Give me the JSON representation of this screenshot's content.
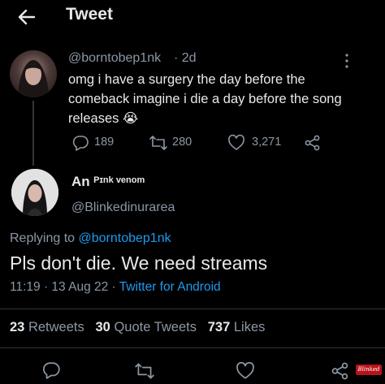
{
  "header": {
    "back_label": "←",
    "title": "Tweet"
  },
  "parent_tweet": {
    "handle": "@borntobep1nk",
    "time": "· 2d",
    "text": "omg i have a surgery the day before the comeback imagine i die a day before the song releases 😭",
    "replies": "189",
    "retweets": "280",
    "likes": "3,271",
    "more_icon": "more-vertical-icon"
  },
  "main_tweet": {
    "display_name_prefix": "An",
    "display_name_suffix": "Pɪnk venom",
    "handle": "@Blinkedinurarea",
    "replying_to_label": "Replying to",
    "replying_to_handle": "@borntobep1nk",
    "text": "Pls don't die. We need streams",
    "timestamp": "11:19 · 13 Aug 22 ·",
    "source": "Twitter for Android"
  },
  "stats": {
    "retweets_count": "23",
    "retweets_label": "Retweets",
    "quotes_count": "30",
    "quotes_label": "Quote Tweets",
    "likes_count": "737",
    "likes_label": "Likes"
  },
  "watermark": "Blinked",
  "colors": {
    "background": "#000000",
    "text": "#e7e9ea",
    "muted": "#8b98a5",
    "accent": "#1d9bf0",
    "divider": "#2f3336"
  }
}
